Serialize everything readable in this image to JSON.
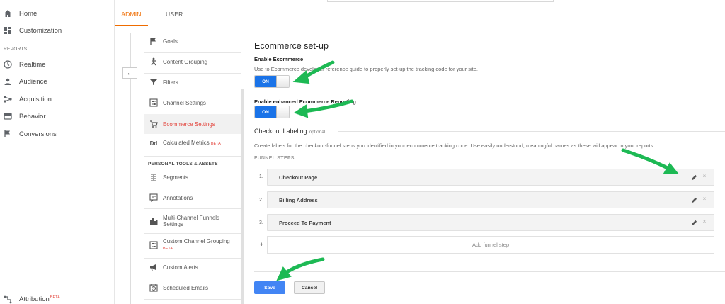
{
  "nav": {
    "home": "Home",
    "customization": "Customization",
    "reports_label": "REPORTS",
    "realtime": "Realtime",
    "audience": "Audience",
    "acquisition": "Acquisition",
    "behavior": "Behavior",
    "conversions": "Conversions",
    "attribution": "Attribution",
    "attribution_badge": "BETA"
  },
  "tabs": {
    "admin": "ADMIN",
    "user": "USER"
  },
  "settings": {
    "goals": "Goals",
    "content_grouping": "Content Grouping",
    "filters": "Filters",
    "channel_settings": "Channel Settings",
    "ecommerce_settings": "Ecommerce Settings",
    "calculated_metrics": "Calculated Metrics",
    "calculated_metrics_badge": "BETA",
    "personal_header": "PERSONAL TOOLS & ASSETS",
    "segments": "Segments",
    "annotations": "Annotations",
    "mcf_line1": "Multi-Channel Funnels",
    "mcf_line2": "Settings",
    "ccg": "Custom Channel Grouping",
    "ccg_badge": "BETA",
    "custom_alerts": "Custom Alerts",
    "scheduled_emails": "Scheduled Emails",
    "calc_icon_text": "Dd"
  },
  "main": {
    "title": "Ecommerce set-up",
    "enable_ecommerce": "Enable Ecommerce",
    "enable_desc": "Use to Ecommerce developer reference guide to properly set-up the tracking code for your site.",
    "toggle_on": "ON",
    "enhanced_label": "Enable enhanced Ecommerce Reporting",
    "checkout_title": "Checkout Labeling",
    "checkout_optional": "optional",
    "checkout_desc": "Create labels for the checkout-funnel steps you identified in your ecommerce tracking code. Use easily understood, meaningful names as these will appear in your reports.",
    "funnel_header": "FUNNEL STEPS",
    "steps": [
      {
        "num": "1.",
        "title": "Checkout Page"
      },
      {
        "num": "2.",
        "title": "Billing Address"
      },
      {
        "num": "3.",
        "title": "Proceed To Payment"
      }
    ],
    "add_plus": "+",
    "add_step": "Add funnel step",
    "save": "Save",
    "cancel": "Cancel"
  },
  "icons": {
    "back": "←",
    "grip": "⋮⋮",
    "remove": "×"
  },
  "colors": {
    "accent_orange": "#ef6c00",
    "active_red": "#e3443c",
    "toggle_blue": "#1a73e8",
    "save_blue": "#4285f4",
    "arrow_green": "#1db954"
  }
}
